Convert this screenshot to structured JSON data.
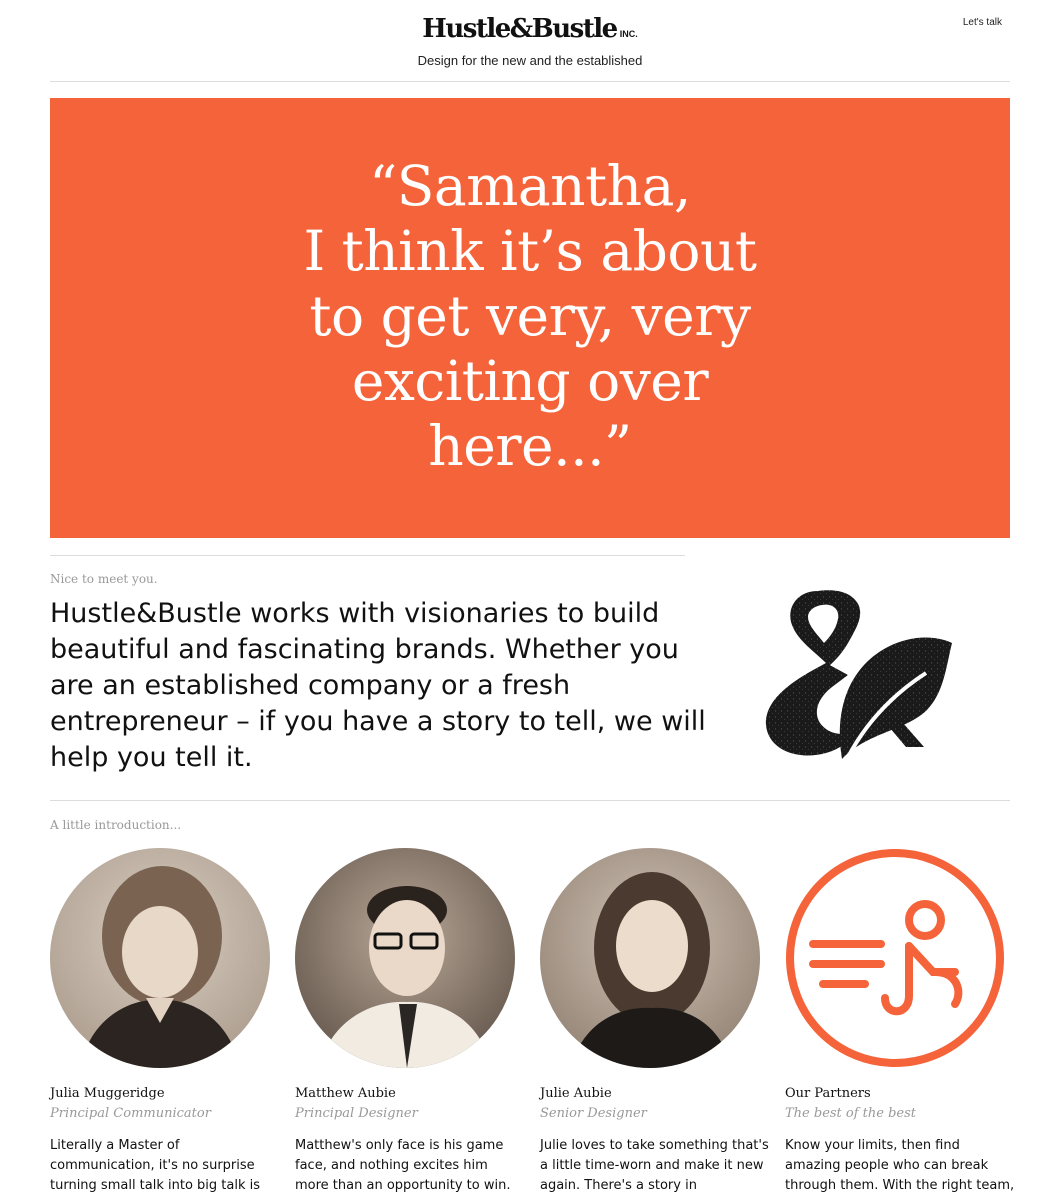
{
  "header": {
    "logo": "Hustle&Bustle",
    "logo_suffix": "INC.",
    "tagline": "Design for the new and the established",
    "cta": "Let's talk"
  },
  "hero": {
    "quote_lines": [
      "“Samantha,",
      "I think it’s about",
      "to get very, very",
      "exciting over",
      "here...”"
    ]
  },
  "intro": {
    "kicker": "Nice to meet you.",
    "text": "Hustle&Bustle works with visionaries to build beautiful and fascinating brands. Whether you are an established company or a fresh entrepreneur – if you have a story to tell, we will help you tell it."
  },
  "team": {
    "kicker": "A little introduction...",
    "members": [
      {
        "name": "Julia Muggeridge",
        "role": "Principal Communicator",
        "bio": "Literally a Master of communication, it's no surprise turning small talk into big talk is"
      },
      {
        "name": "Matthew Aubie",
        "role": "Principal Designer",
        "bio": "Matthew's only face is his game face, and nothing excites him more than an opportunity to win."
      },
      {
        "name": "Julie Aubie",
        "role": "Senior Designer",
        "bio": "Julie loves to take something that's a little time-worn and make it new again. There's a story in"
      },
      {
        "name": "Our Partners",
        "role": "The best of the best",
        "bio": "Know your limits, then find amazing people who can break through them. With the right team,"
      }
    ]
  },
  "colors": {
    "accent": "#f5633a",
    "rule": "#dddddd",
    "muted_text": "#999999"
  }
}
